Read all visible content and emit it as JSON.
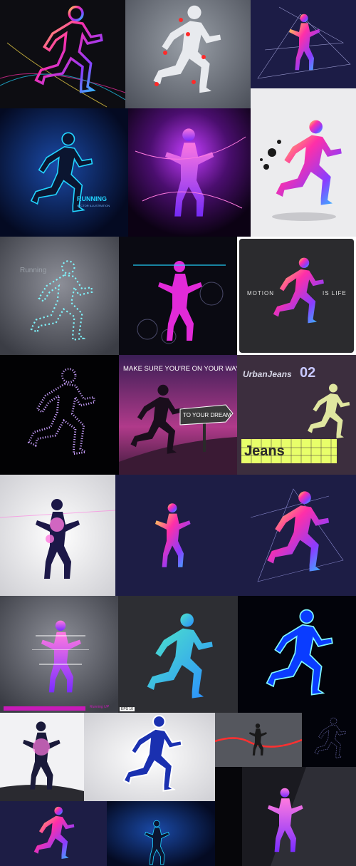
{
  "collage": {
    "background": "#111111",
    "tiles": [
      {
        "id": "t1",
        "texts": {}
      },
      {
        "id": "t2",
        "texts": {}
      },
      {
        "id": "t3",
        "texts": {}
      },
      {
        "id": "t4",
        "texts": {
          "title": "RUNNING",
          "sub": "VECTOR ILLUSTRATION"
        }
      },
      {
        "id": "t5",
        "texts": {}
      },
      {
        "id": "t6",
        "texts": {}
      },
      {
        "id": "t7",
        "texts": {
          "title": "Running"
        }
      },
      {
        "id": "t8",
        "texts": {}
      },
      {
        "id": "t9",
        "texts": {
          "left": "MOTION",
          "right": "IS LIFE"
        }
      },
      {
        "id": "t10",
        "texts": {}
      },
      {
        "id": "t11",
        "texts": {
          "headline": "MAKE SURE YOU'RE ON YOUR WAY",
          "sign": "TO YOUR DREAM"
        }
      },
      {
        "id": "t12",
        "texts": {
          "brand": "UrbanJeans",
          "number": "02",
          "jeans": "Jeans"
        }
      },
      {
        "id": "t13",
        "texts": {}
      },
      {
        "id": "t14",
        "texts": {}
      },
      {
        "id": "t15",
        "texts": {}
      },
      {
        "id": "t16",
        "texts": {
          "banner": "Running UP",
          "tag": "EPS 10"
        }
      },
      {
        "id": "t17",
        "texts": {}
      },
      {
        "id": "t18",
        "texts": {}
      },
      {
        "id": "t19",
        "texts": {}
      },
      {
        "id": "t20",
        "texts": {}
      },
      {
        "id": "t21",
        "texts": {}
      },
      {
        "id": "t22",
        "texts": {}
      },
      {
        "id": "t23",
        "texts": {}
      },
      {
        "id": "t24",
        "texts": {}
      },
      {
        "id": "t25",
        "texts": {}
      }
    ]
  },
  "palette": {
    "pink": "#ff2fa8",
    "cyan": "#22d4ff",
    "purple": "#8a3cff",
    "orange": "#ff8a1f",
    "yellow": "#ffe14a",
    "green": "#3ee08a"
  }
}
